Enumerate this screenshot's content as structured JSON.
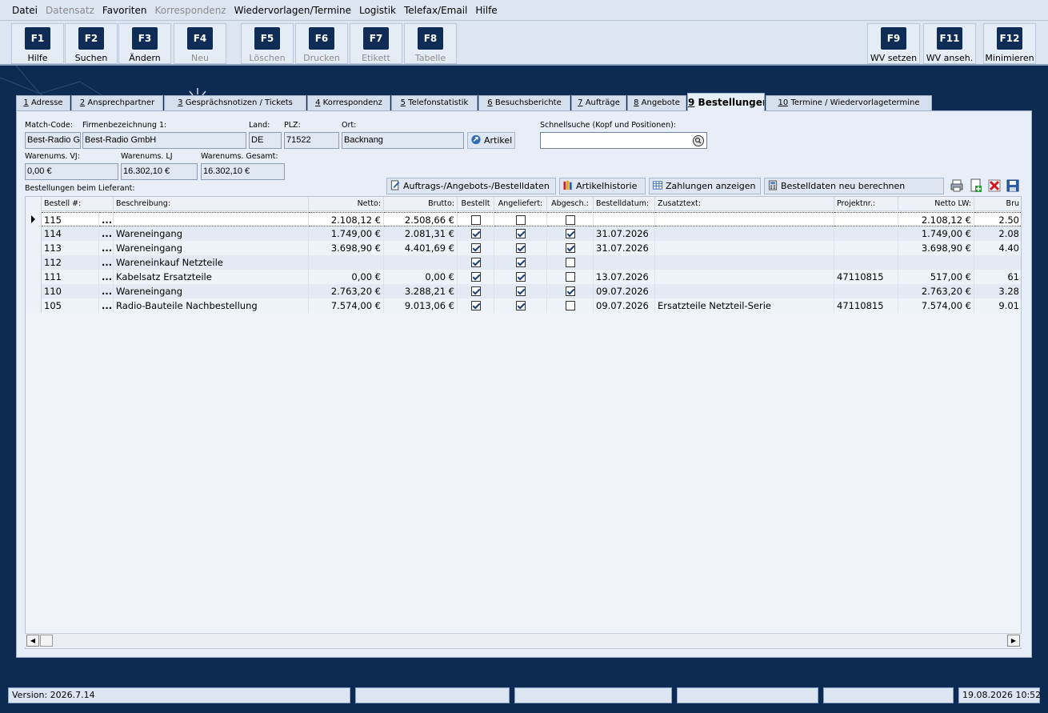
{
  "menu": {
    "items": [
      {
        "label": "Datei",
        "enabled": true
      },
      {
        "label": "Datensatz",
        "enabled": false
      },
      {
        "label": "Favoriten",
        "enabled": true
      },
      {
        "label": "Korrespondenz",
        "enabled": false
      },
      {
        "label": "Wiedervorlagen/Termine",
        "enabled": true
      },
      {
        "label": "Logistik",
        "enabled": true
      },
      {
        "label": "Telefax/Email",
        "enabled": true
      },
      {
        "label": "Hilfe",
        "enabled": true
      }
    ]
  },
  "toolbar": {
    "buttons": [
      {
        "key": "F1",
        "label": "Hilfe",
        "enabled": true
      },
      {
        "key": "F2",
        "label": "Suchen",
        "enabled": true
      },
      {
        "key": "F3",
        "label": "Ändern",
        "enabled": true
      },
      {
        "key": "F4",
        "label": "Neu",
        "enabled": false
      },
      {
        "key": "F5",
        "label": "Löschen",
        "enabled": false
      },
      {
        "key": "F6",
        "label": "Drucken",
        "enabled": false
      },
      {
        "key": "F7",
        "label": "Etikett",
        "enabled": false
      },
      {
        "key": "F8",
        "label": "Tabelle",
        "enabled": false
      },
      {
        "key": "F9",
        "label": "WV setzen",
        "enabled": true
      },
      {
        "key": "F11",
        "label": "WV anseh.",
        "enabled": true
      },
      {
        "key": "F12",
        "label": "Minimieren",
        "enabled": true
      }
    ]
  },
  "tabs": [
    {
      "num": "1",
      "label": "Adresse"
    },
    {
      "num": "2",
      "label": "Ansprechpartner"
    },
    {
      "num": "3",
      "label": "Gesprächsnotizen / Tickets"
    },
    {
      "num": "4",
      "label": "Korrespondenz"
    },
    {
      "num": "5",
      "label": "Telefonstatistik"
    },
    {
      "num": "6",
      "label": "Besuchsberichte"
    },
    {
      "num": "7",
      "label": "Aufträge"
    },
    {
      "num": "8",
      "label": "Angebote"
    },
    {
      "num": "9",
      "label": "Bestellungen",
      "active": true
    },
    {
      "num": "10",
      "label": "Termine / Wiedervorlagetermine"
    }
  ],
  "header": {
    "matchcode_label": "Match-Code:",
    "matchcode_value": "Best-Radio Gr",
    "firma_label": "Firmenbezeichnung 1:",
    "firma_value": "Best-Radio GmbH",
    "land_label": "Land:",
    "land_value": "DE",
    "plz_label": "PLZ:",
    "plz_value": "71522",
    "ort_label": "Ort:",
    "ort_value": "Backnang",
    "artikel_button": "Artikel",
    "search_label": "Schnellsuche (Kopf und Positionen):",
    "search_value": "",
    "warenums_vj_label": "Warenums. VJ:",
    "warenums_vj_value": "0,00 €",
    "warenums_lj_label": "Warenums. LJ",
    "warenums_lj_value": "16.302,10 €",
    "warenums_gesamt_label": "Warenums. Gesamt:",
    "warenums_gesamt_value": "16.302,10 €",
    "list_label": "Bestellungen beim Lieferant:"
  },
  "actions": {
    "auftrags": "Auftrags-/Angebots-/Bestelldaten",
    "artikelhistorie": "Artikelhistorie",
    "zahlungen": "Zahlungen anzeigen",
    "neu_berechnen": "Bestelldaten neu berechnen"
  },
  "grid": {
    "columns": [
      "Bestell #:",
      "Beschreibung:",
      "Netto:",
      "Brutto:",
      "Bestellt",
      "Angeliefert:",
      "Abgesch.:",
      "Bestelldatum:",
      "Zusatztext:",
      "Projektnr.:",
      "Netto LW:",
      "Bru"
    ],
    "rows": [
      {
        "nr": "115",
        "desc": "",
        "netto": "2.108,12 €",
        "brutto": "2.508,66 €",
        "bestellt": false,
        "angeliefert": false,
        "abgesch": false,
        "datum": "",
        "zusatz": "",
        "projekt": "",
        "netto_lw": "2.108,12 €",
        "brutto_lw": "2.50",
        "selected": true
      },
      {
        "nr": "114",
        "desc": "Wareneingang",
        "netto": "1.749,00 €",
        "brutto": "2.081,31 €",
        "bestellt": true,
        "angeliefert": true,
        "abgesch": true,
        "datum": "31.07.2026",
        "zusatz": "",
        "projekt": "",
        "netto_lw": "1.749,00 €",
        "brutto_lw": "2.08"
      },
      {
        "nr": "113",
        "desc": "Wareneingang",
        "netto": "3.698,90 €",
        "brutto": "4.401,69 €",
        "bestellt": true,
        "angeliefert": true,
        "abgesch": true,
        "datum": "31.07.2026",
        "zusatz": "",
        "projekt": "",
        "netto_lw": "3.698,90 €",
        "brutto_lw": "4.40"
      },
      {
        "nr": "112",
        "desc": "Wareneinkauf Netzteile",
        "netto": "",
        "brutto": "",
        "bestellt": true,
        "angeliefert": true,
        "abgesch": false,
        "datum": "",
        "zusatz": "",
        "projekt": "",
        "netto_lw": "",
        "brutto_lw": ""
      },
      {
        "nr": "111",
        "desc": "Kabelsatz Ersatzteile",
        "netto": "0,00 €",
        "brutto": "0,00 €",
        "bestellt": true,
        "angeliefert": true,
        "abgesch": false,
        "datum": "13.07.2026",
        "zusatz": "",
        "projekt": "47110815",
        "netto_lw": "517,00 €",
        "brutto_lw": "61"
      },
      {
        "nr": "110",
        "desc": "Wareneingang",
        "netto": "2.763,20 €",
        "brutto": "3.288,21 €",
        "bestellt": true,
        "angeliefert": true,
        "abgesch": true,
        "datum": "09.07.2026",
        "zusatz": "",
        "projekt": "",
        "netto_lw": "2.763,20 €",
        "brutto_lw": "3.28"
      },
      {
        "nr": "105",
        "desc": "Radio-Bauteile Nachbestellung",
        "netto": "7.574,00 €",
        "brutto": "9.013,06 €",
        "bestellt": true,
        "angeliefert": true,
        "abgesch": false,
        "datum": "09.07.2026",
        "zusatz": "Ersatzteile Netzteil-Serie",
        "projekt": "47110815",
        "netto_lw": "7.574,00 €",
        "brutto_lw": "9.01"
      }
    ],
    "ellipsis": "..."
  },
  "status": {
    "version": "Version: 2026.7.14",
    "datetime": "19.08.2026 10:52"
  },
  "colors": {
    "background": "#0d2a52",
    "key_badge": "#0f2c57"
  }
}
